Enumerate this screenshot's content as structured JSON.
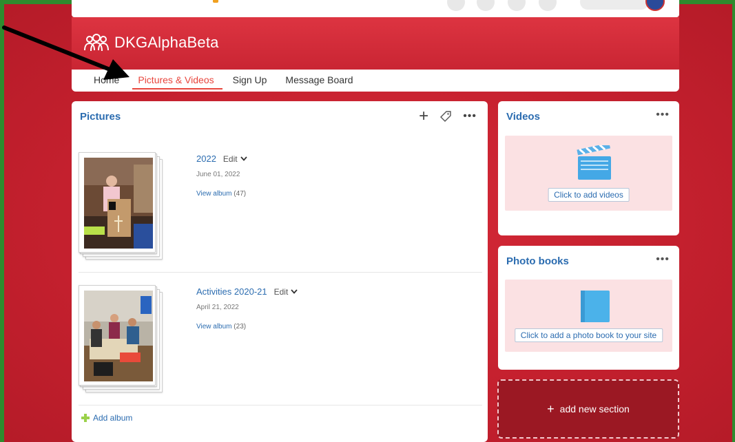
{
  "site": {
    "title": "DKGAlphaBeta"
  },
  "nav": {
    "tabs": [
      {
        "label": "Home"
      },
      {
        "label": "Pictures & Videos",
        "active": true
      },
      {
        "label": "Sign Up"
      },
      {
        "label": "Message Board"
      }
    ]
  },
  "pictures": {
    "title": "Pictures",
    "albums": [
      {
        "name": "2022",
        "edit_label": "Edit",
        "date": "June 01, 2022",
        "view_label": "View album",
        "count": "(47)"
      },
      {
        "name": "Activities 2020-21",
        "edit_label": "Edit",
        "date": "April 21, 2022",
        "view_label": "View album",
        "count": "(23)"
      }
    ],
    "add_album_label": "Add album"
  },
  "videos": {
    "title": "Videos",
    "button_label": "Click to add videos"
  },
  "books": {
    "title": "Photo books",
    "button_label": "Click to add a photo book to your site"
  },
  "add_section": {
    "label": "add new section"
  },
  "colors": {
    "frame": "#2e8b2e",
    "background_red": "#c4202e",
    "accent": "#e8453c",
    "link": "#2b6cb0",
    "panel_pink": "#fbe1e3",
    "add_section_bg": "#9b1823"
  }
}
